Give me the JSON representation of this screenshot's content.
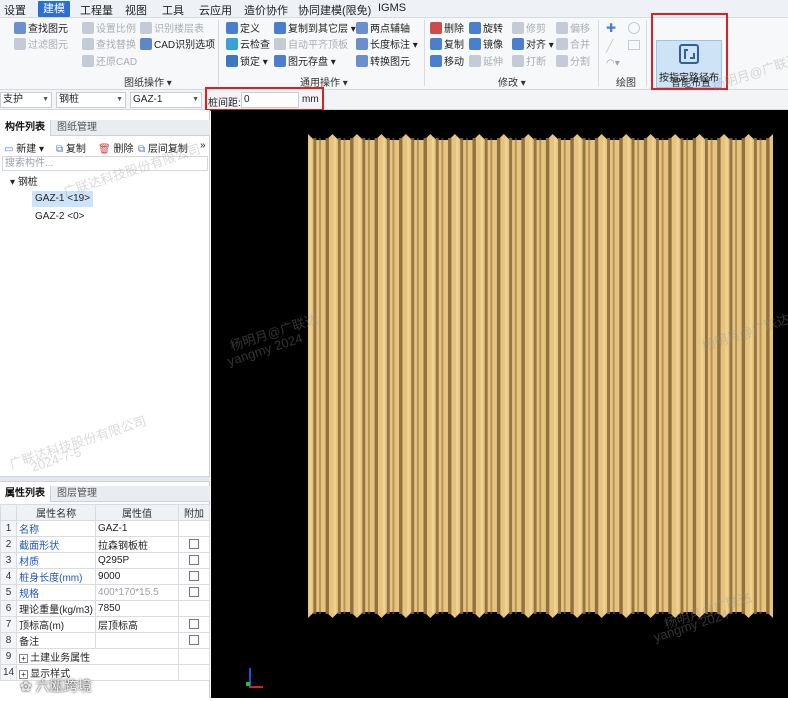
{
  "menubar": {
    "items": [
      "设置",
      "建模",
      "工程量",
      "视图",
      "工具",
      "云应用",
      "造价协作",
      "协同建模(限免)",
      "IGMS"
    ],
    "active": "建模"
  },
  "ribbon": {
    "drawing_ops": {
      "label": "图纸操作",
      "buttons": [
        "查找图元",
        "过滤图元",
        "设置比例",
        "查找替换",
        "还原CAD",
        "识别楼层表",
        "CAD识别选项"
      ]
    },
    "general_ops": {
      "label": "通用操作",
      "buttons": [
        "定义",
        "云检查",
        "锁定",
        "复制到其它层",
        "自动平齐顶板",
        "图元存盘",
        "两点辅轴",
        "长度标注",
        "转换图元"
      ]
    },
    "modify": {
      "label": "修改",
      "buttons": [
        "删除",
        "复制",
        "移动",
        "旋转",
        "镜像",
        "延伸",
        "修剪",
        "对齐",
        "打断",
        "偏移",
        "合并",
        "分割"
      ]
    },
    "draw": {
      "label": "绘图"
    },
    "smart_layout": {
      "label": "智能布置",
      "button": "按指定路径布置"
    }
  },
  "propbar": {
    "category": "支护",
    "type": "钢桩",
    "component": "GAZ-1",
    "spacing_label": "桩间距:",
    "spacing_value": "0",
    "spacing_unit": "mm"
  },
  "component_list": {
    "tabs": [
      "构件列表",
      "图纸管理"
    ],
    "toolbar": [
      "新建",
      "复制",
      "删除",
      "层间复制"
    ],
    "search_placeholder": "搜索构件...",
    "root": "钢桩",
    "items": [
      "GAZ-1 <19>",
      "GAZ-2 <0>"
    ],
    "selected": "GAZ-1 <19>"
  },
  "property_list": {
    "tabs": [
      "属性列表",
      "图层管理"
    ],
    "headers": [
      "属性名称",
      "属性值",
      "附加"
    ],
    "rows": [
      {
        "idx": "1",
        "name": "名称",
        "value": "GAZ-1",
        "check": false
      },
      {
        "idx": "2",
        "name": "截面形状",
        "value": "拉森钢板桩",
        "check": true
      },
      {
        "idx": "3",
        "name": "材质",
        "value": "Q295P",
        "check": true
      },
      {
        "idx": "4",
        "name": "桩身长度(mm)",
        "value": "9000",
        "check": true
      },
      {
        "idx": "5",
        "name": "规格",
        "value": "400*170*15.5",
        "check": true
      },
      {
        "idx": "6",
        "name": "理论重量(kg/m3)",
        "value": "7850",
        "check": false
      },
      {
        "idx": "7",
        "name": "顶标高(m)",
        "value": "层顶标高",
        "check": true
      },
      {
        "idx": "8",
        "name": "备注",
        "value": "",
        "check": true
      },
      {
        "idx": "9",
        "name": "土建业务属性",
        "value": "",
        "check": false,
        "expand": true
      },
      {
        "idx": "14",
        "name": "显示样式",
        "value": "",
        "check": false,
        "expand": true
      }
    ]
  },
  "canvas": {
    "pile_count": 19,
    "pile_color_light": "#e6c47f",
    "pile_color_dark": "#8c6d3b",
    "background": "#000000"
  },
  "watermarks": [
    "杨明月@广联达",
    "yangmy 2024",
    "广联达科技股份有限公司",
    "2024-7-5"
  ],
  "corner_logo": "六瓯跨境",
  "colors": {
    "accent": "#2b6fd6",
    "highlight": "#e02020"
  }
}
